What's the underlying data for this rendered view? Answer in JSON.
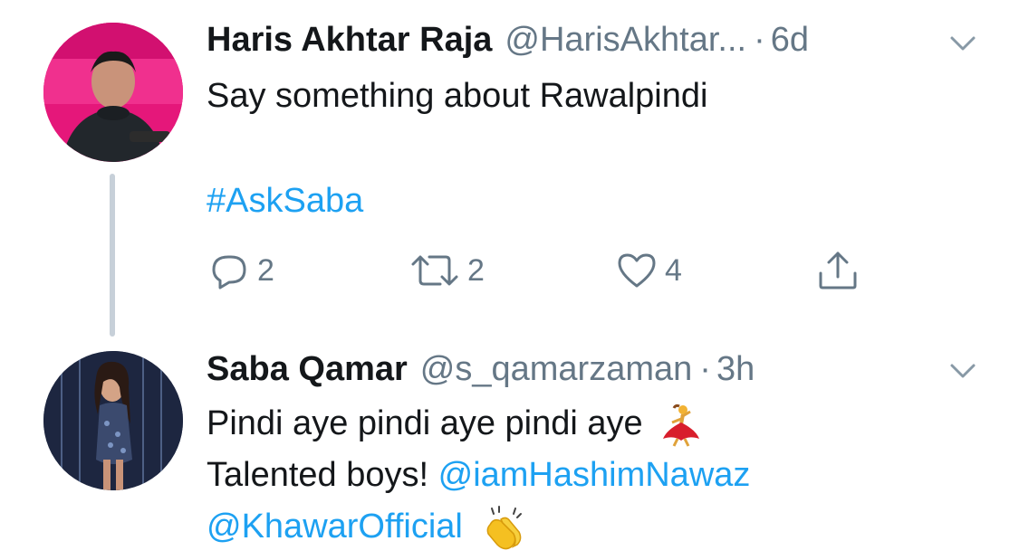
{
  "tweet1": {
    "name": "Haris Akhtar Raja",
    "handle": "@HarisAkhtar...",
    "dot": "·",
    "time": "6d",
    "text": "Say something about Rawalpindi",
    "hashtag": "#AskSaba",
    "actions": {
      "reply_count": "2",
      "retweet_count": "2",
      "like_count": "4"
    }
  },
  "tweet2": {
    "name": "Saba Qamar",
    "handle": "@s_qamarzaman",
    "dot": "·",
    "time": "3h",
    "line1": "Pindi aye pindi aye pindi aye",
    "line2_text": "Talented boys!",
    "line2_mention": "@iamHashimNawaz",
    "line3_mention": "@KhawarOfficial"
  },
  "icons": {
    "reply": "reply-icon",
    "retweet": "retweet-icon",
    "like": "heart-icon",
    "share": "share-icon",
    "chevron": "chevron-down-icon",
    "dancer": "dancer-emoji",
    "clap": "clapping-hands-emoji"
  },
  "colors": {
    "link": "#1da1f2",
    "secondary": "#657786",
    "text": "#14171a",
    "thread_line": "#c7d0d9"
  }
}
